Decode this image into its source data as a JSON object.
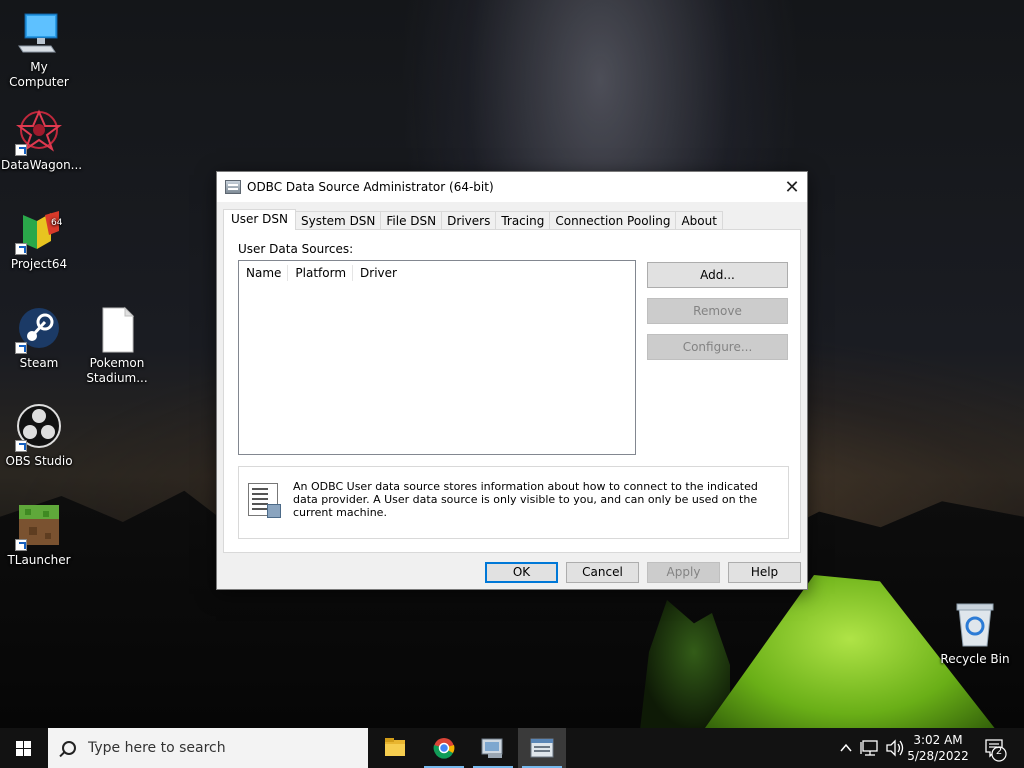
{
  "desktop": {
    "icons": [
      {
        "label": "My Computer"
      },
      {
        "label": "DataWagon..."
      },
      {
        "label": "Project64"
      },
      {
        "label": "Steam"
      },
      {
        "label": "Pokemon Stadium..."
      },
      {
        "label": "OBS Studio"
      },
      {
        "label": "TLauncher"
      },
      {
        "label": "Recycle Bin"
      }
    ]
  },
  "dialog": {
    "title": "ODBC Data Source Administrator (64-bit)",
    "close_glyph": "✕",
    "tabs": [
      {
        "label": "User DSN",
        "active": true
      },
      {
        "label": "System DSN"
      },
      {
        "label": "File DSN"
      },
      {
        "label": "Drivers"
      },
      {
        "label": "Tracing"
      },
      {
        "label": "Connection Pooling"
      },
      {
        "label": "About"
      }
    ],
    "section_label": "User Data Sources:",
    "columns": [
      "Name",
      "Platform",
      "Driver"
    ],
    "buttons": {
      "add": "Add...",
      "remove": "Remove",
      "configure": "Configure..."
    },
    "info_text": "An ODBC User data source stores information about how to connect to the indicated data provider.   A User data source is only visible to you, and can only be used on the current machine.",
    "footer": {
      "ok": "OK",
      "cancel": "Cancel",
      "apply": "Apply",
      "help": "Help"
    }
  },
  "taskbar": {
    "search_placeholder": "Type here to search",
    "time": "3:02 AM",
    "date": "5/28/2022",
    "notification_count": "2"
  },
  "colors": {
    "accent": "#0078d7",
    "taskbar": "#121212"
  }
}
